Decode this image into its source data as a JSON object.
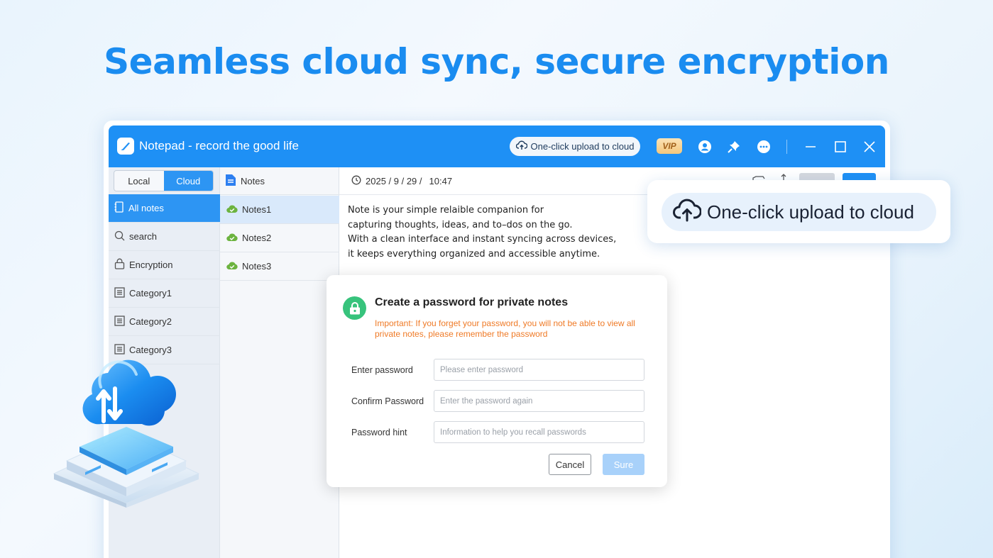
{
  "headline": "Seamless cloud sync, secure encryption",
  "window": {
    "title": "Notepad - record the good life",
    "upload_button": "One-click upload to cloud",
    "vip_badge": "VIP",
    "icons": [
      "user-icon",
      "pin-icon",
      "more-icon",
      "minimize-icon",
      "maximize-icon",
      "close-icon"
    ]
  },
  "sidebar": {
    "tabs": [
      "Local",
      "Cloud"
    ],
    "active_tab": "Cloud",
    "items": [
      {
        "label": "All notes",
        "icon": "notebook-icon"
      },
      {
        "label": "search",
        "icon": "search-icon"
      },
      {
        "label": "Encryption",
        "icon": "lock-icon"
      },
      {
        "label": "Category1",
        "icon": "list-icon"
      },
      {
        "label": "Category2",
        "icon": "list-icon"
      },
      {
        "label": "Category3",
        "icon": "list-icon"
      }
    ]
  },
  "notes_list": {
    "header": "Notes",
    "items": [
      "Notes1",
      "Notes2",
      "Notes3"
    ]
  },
  "editor": {
    "date": "2025 / 9 / 29 /",
    "time": "10:47",
    "content": [
      "Note is your simple relaible companion for",
      "capturing thoughts, ideas, and to–dos on the go.",
      "With a clean interface and instant syncing across devices,",
      "it keeps everything organized and accessible anytime."
    ]
  },
  "dialog": {
    "title": "Create a password for private notes",
    "warning": "Important: If you forget your password, you will not be able to view all private notes, please remember the password",
    "fields": [
      {
        "label": "Enter password",
        "placeholder": "Please enter password"
      },
      {
        "label": "Confirm Password",
        "placeholder": "Enter the password again"
      },
      {
        "label": "Password hint",
        "placeholder": "Information to help you recall passwords"
      }
    ],
    "cancel": "Cancel",
    "confirm": "Sure"
  },
  "callout": {
    "label": "One-click upload to cloud"
  },
  "colors": {
    "accent": "#1e90f5",
    "headline": "#1a8cf0",
    "warning": "#ef7a26",
    "success": "#37c37c"
  }
}
